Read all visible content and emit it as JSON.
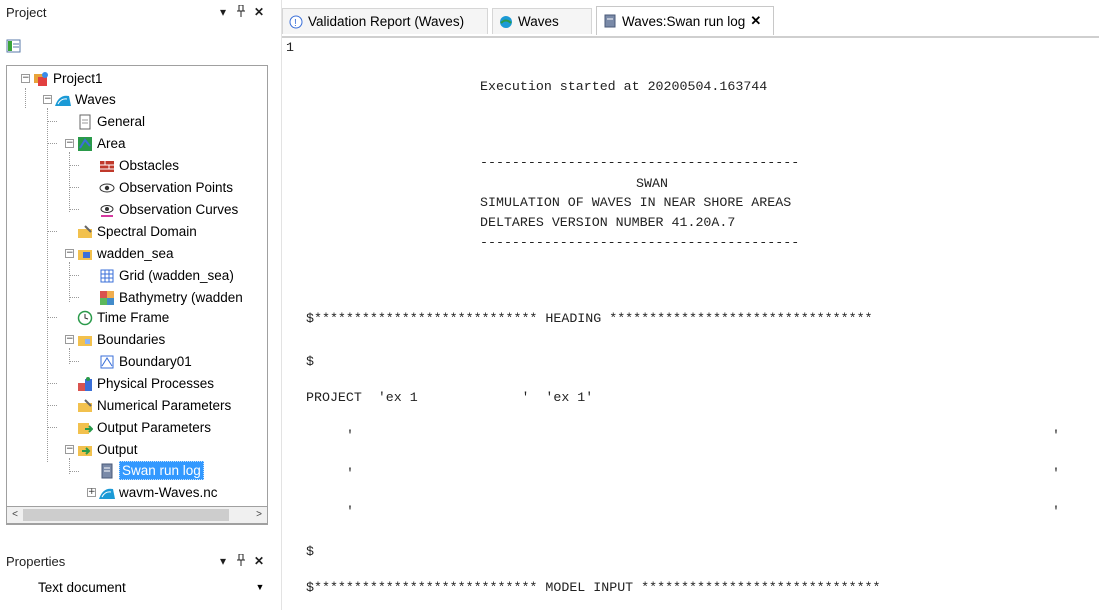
{
  "project_panel": {
    "title": "Project",
    "pin_glyph": "▾",
    "autohide_glyph": "📌",
    "close_glyph": "✕",
    "tree": {
      "project": "Project1",
      "waves": "Waves",
      "general": "General",
      "area": "Area",
      "obstacles": "Obstacles",
      "observation_points": "Observation Points",
      "observation_curves": "Observation Curves",
      "spectral_domain": "Spectral Domain",
      "wadden_sea": "wadden_sea",
      "grid": "Grid (wadden_sea)",
      "bathymetry": "Bathymetry (wadden",
      "time_frame": "Time Frame",
      "boundaries": "Boundaries",
      "boundary01": "Boundary01",
      "physical_processes": "Physical Processes",
      "numerical_parameters": "Numerical Parameters",
      "output_parameters": "Output Parameters",
      "output": "Output",
      "swan_run_log": "Swan run log",
      "wavm_file": "wavm-Waves.nc"
    }
  },
  "properties_panel": {
    "title": "Properties",
    "selected_value": "Text document"
  },
  "tabs": [
    {
      "label": "Validation Report (Waves)"
    },
    {
      "label": "Waves"
    },
    {
      "label": "Waves:Swan run log",
      "close": "✕"
    }
  ],
  "log": {
    "line_number": "1",
    "lines": [
      "Execution started at 20200504.163744",
      "----------------------------------------",
      "SWAN",
      "SIMULATION OF WAVES IN NEAR SHORE AREAS",
      "DELTARES VERSION NUMBER 41.20A.7",
      "----------------------------------------",
      "$**************************** HEADING *********************************",
      "$",
      "PROJECT  'ex 1             '  'ex 1'",
      "'",
      "'",
      "'",
      "'",
      "'",
      "'",
      "$",
      "$**************************** MODEL INPUT ******************************"
    ]
  },
  "colors": {
    "selection": "#3399ff",
    "waves_icon": "#1b9ad6",
    "obstacles_icon": "#c0392b"
  }
}
